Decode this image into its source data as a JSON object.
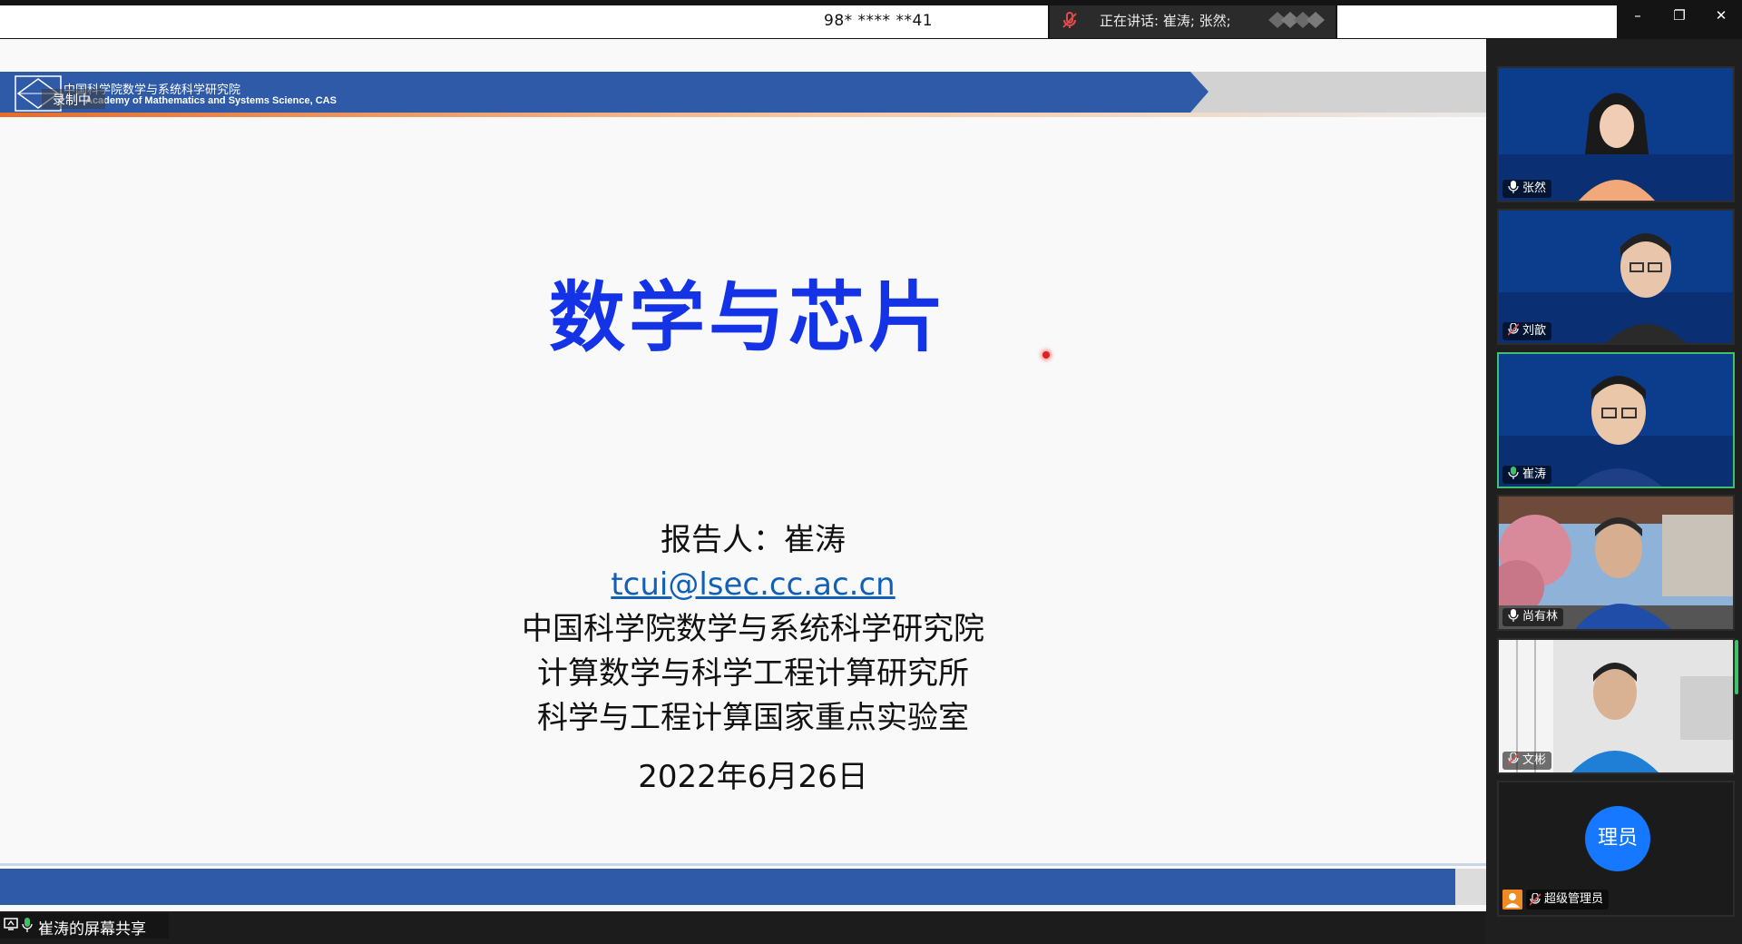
{
  "topbar": {
    "meeting_id": "98* **** **41",
    "speaking_label": "正在讲话: 崔涛; 张然;",
    "window_controls": {
      "minimize": "–",
      "restore": "❐",
      "close": "✕"
    }
  },
  "slide": {
    "header_cn": "中国科学院数学与系统科学研究院",
    "header_en": "Academy of Mathematics and Systems Science, CAS",
    "recording_label": "录制中",
    "title": "数学与芯片",
    "lines": {
      "presenter": "报告人：崔涛",
      "email": "tcui@lsec.cc.ac.cn",
      "institute": "中国科学院数学与系统科学研究院",
      "dept": "计算数学与科学工程计算研究所",
      "lab": "科学与工程计算国家重点实验室",
      "date": "2022年6月26日"
    },
    "colors": {
      "title": "#1433e6",
      "header_band": "#2e5aa8",
      "accent": "#e46d2a"
    }
  },
  "share_badge": {
    "label": "崔涛的屏幕共享"
  },
  "participants": [
    {
      "name": "张然",
      "mic": "on",
      "active": false
    },
    {
      "name": "刘歆",
      "mic": "muted",
      "active": false
    },
    {
      "name": "崔涛",
      "mic": "on",
      "active": true
    },
    {
      "name": "尚有林",
      "mic": "on",
      "active": false
    },
    {
      "name": "文彬",
      "mic": "muted",
      "active": false
    }
  ],
  "admin": {
    "avatar_text": "理员",
    "label": "超级管理员"
  },
  "status_colors": {
    "speaking": "#3fc16b",
    "avatar": "#1677ff"
  }
}
